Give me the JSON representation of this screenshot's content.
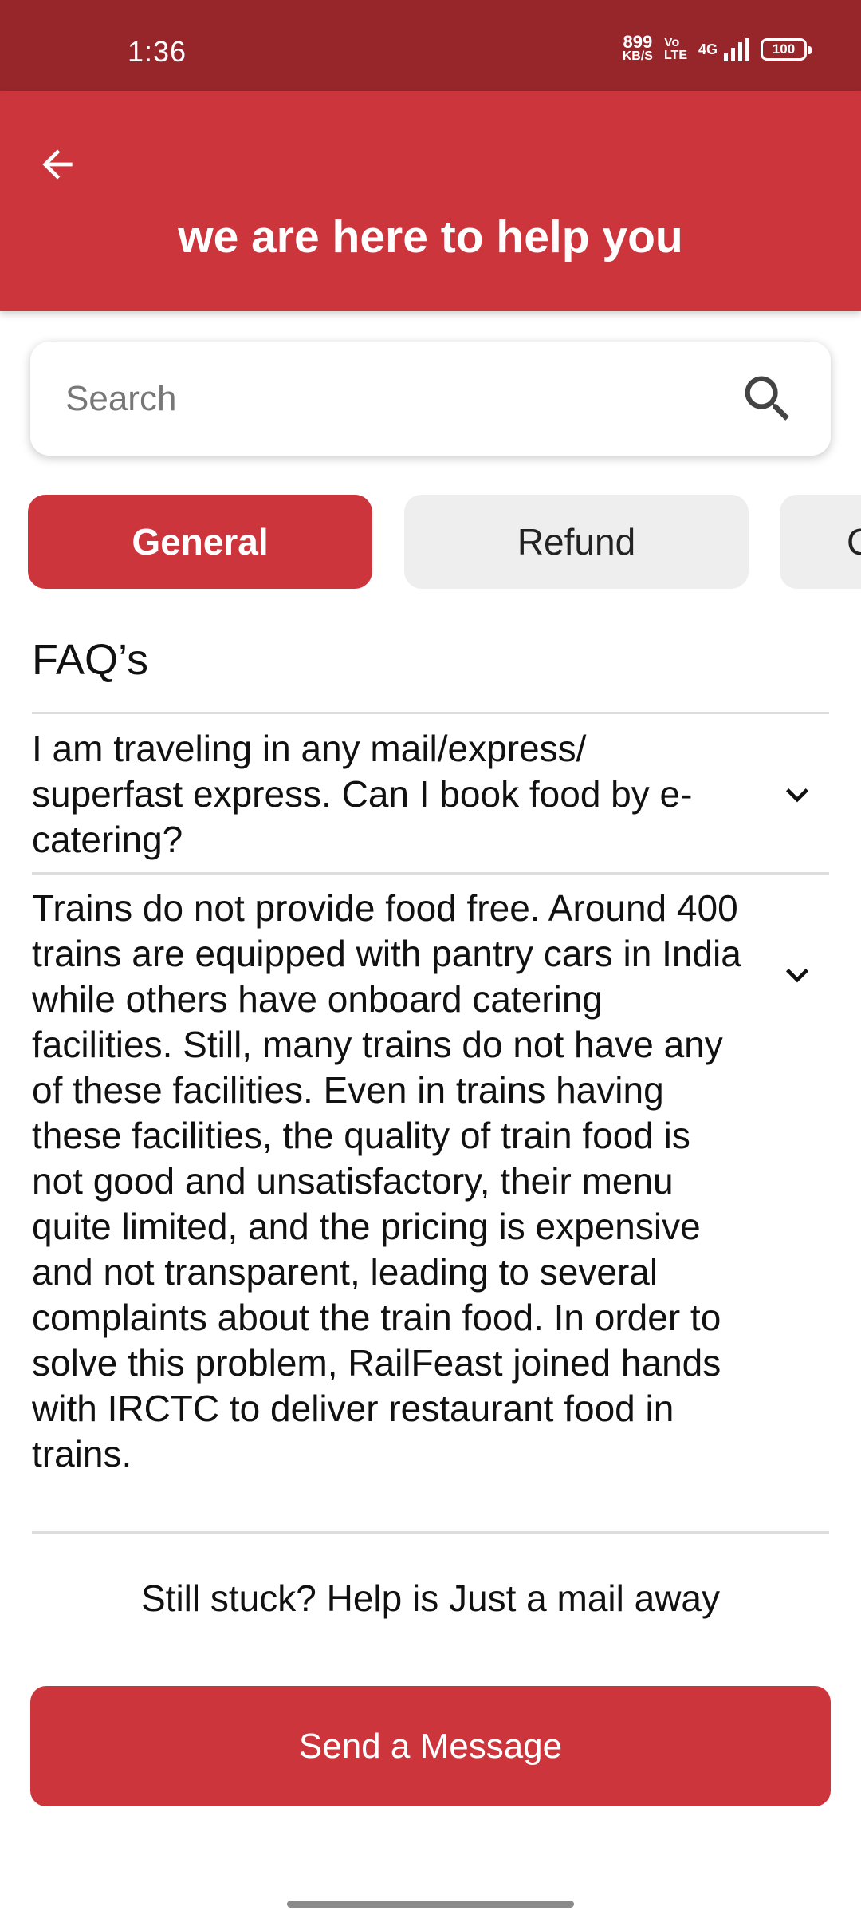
{
  "status_bar": {
    "time": "1:36",
    "net_speed_value": "899",
    "net_speed_unit": "KB/S",
    "volte_top": "Vo",
    "volte_bottom": "LTE",
    "network_type": "4G",
    "battery_level": "100"
  },
  "header": {
    "back_icon": "arrow-left-icon",
    "title": "we are here to help you",
    "color": "#cc353c"
  },
  "search": {
    "placeholder": "Search",
    "icon": "search-icon"
  },
  "tabs": [
    {
      "label": "General",
      "active": true
    },
    {
      "label": "Refund",
      "active": false
    },
    {
      "label": "C",
      "active": false
    }
  ],
  "faq": {
    "heading": "FAQ’s",
    "items": [
      {
        "question": "I am traveling in any mail/express/ superfast express. Can I book food by e-catering?"
      },
      {
        "question": "Trains do not provide food free. Around 400 trains are equipped with pantry cars in India while others have onboard catering facilities. Still, many trains do not have any of these facilities. Even in trains having these facilities, the quality of train food is not good and unsatisfactory, their menu quite limited, and the pricing is expensive and not transparent, leading to several complaints about the train food. In order to solve this problem, RailFeast joined hands with IRCTC to deliver restaurant food in trains."
      }
    ]
  },
  "help": {
    "text": "Still stuck? Help is Just a mail away",
    "button_label": "Send a Message"
  }
}
